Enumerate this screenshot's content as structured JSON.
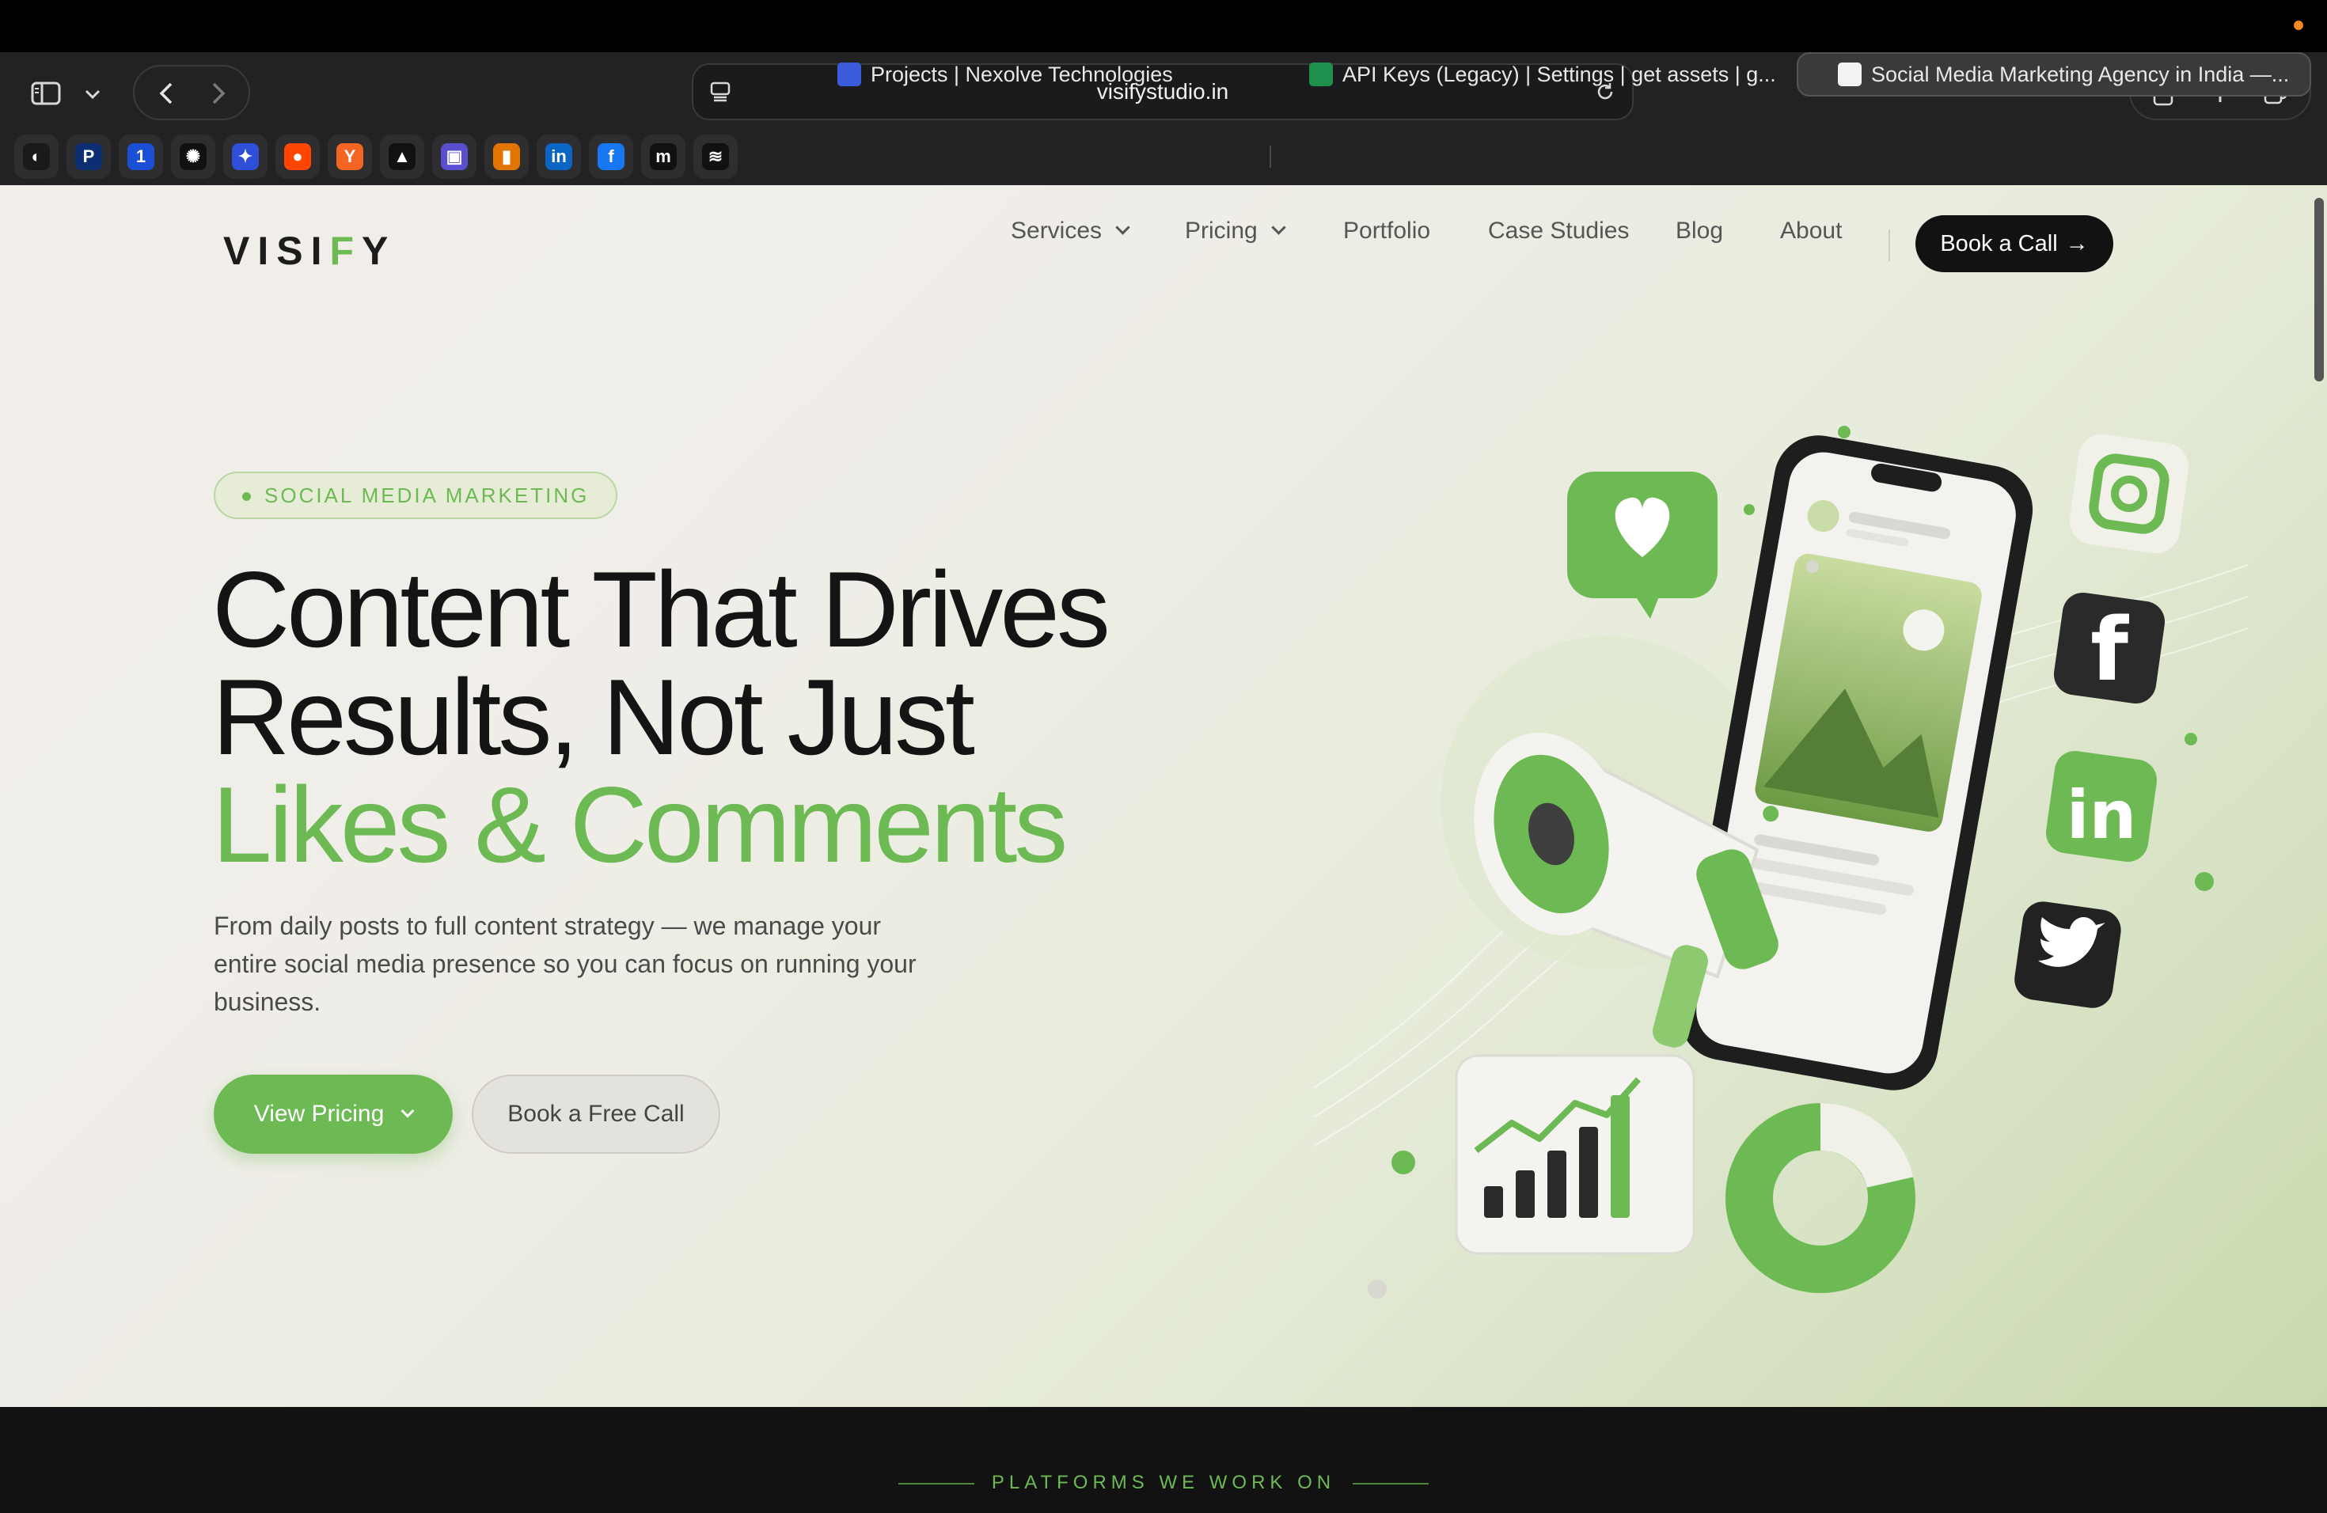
{
  "browser": {
    "url": "visifystudio.in",
    "favorites": [
      {
        "icon": "lime-app-icon",
        "color": "#1a1a1a"
      },
      {
        "icon": "paypal-icon",
        "color": "#0d2e73"
      },
      {
        "icon": "one-icon",
        "color": "#1a4fd6"
      },
      {
        "icon": "openai-icon",
        "color": "#111111"
      },
      {
        "icon": "gemini-icon",
        "color": "#2f4fd8"
      },
      {
        "icon": "reddit-icon",
        "color": "#ff4500"
      },
      {
        "icon": "ycombinator-icon",
        "color": "#f26522"
      },
      {
        "icon": "triangle-app-icon",
        "color": "#111111"
      },
      {
        "icon": "save-app-icon",
        "color": "#5b4fd1"
      },
      {
        "icon": "analytics-icon",
        "color": "#e37400"
      },
      {
        "icon": "linkedin-icon",
        "color": "#0a66c2"
      },
      {
        "icon": "facebook-icon",
        "color": "#1877f2"
      },
      {
        "icon": "medium-icon",
        "color": "#111111"
      },
      {
        "icon": "layers-app-icon",
        "color": "#111111"
      }
    ],
    "tabs": [
      {
        "title": "Projects | Nexolve Technologies",
        "icon_color": "#3b5bdb"
      },
      {
        "title": "API Keys (Legacy) | Settings | get assets | g...",
        "icon_color": "#1f8f4e"
      },
      {
        "title": "Social Media Marketing Agency in India —...",
        "icon_color": "#ffffff"
      }
    ]
  },
  "site": {
    "logo_pre": "VISI",
    "logo_f": "F",
    "logo_post": "Y",
    "nav": {
      "services": "Services",
      "pricing": "Pricing",
      "portfolio": "Portfolio",
      "case_studies": "Case Studies",
      "blog": "Blog",
      "about": "About",
      "cta": "Book a Call",
      "cta_arrow": "→"
    },
    "hero": {
      "badge": "SOCIAL MEDIA MARKETING",
      "title_line1": "Content That Drives",
      "title_line2": "Results, Not Just",
      "title_line3": "Likes & Comments",
      "subtitle": "From daily posts to full content strategy — we manage your entire social media presence so you can focus on running your business.",
      "primary_button": "View Pricing",
      "secondary_button": "Book a Free Call"
    },
    "platforms_heading": "PLATFORMS WE WORK ON"
  },
  "colors": {
    "accent_green": "#6dba55",
    "dark": "#121212",
    "browser_chrome": "#222224"
  }
}
